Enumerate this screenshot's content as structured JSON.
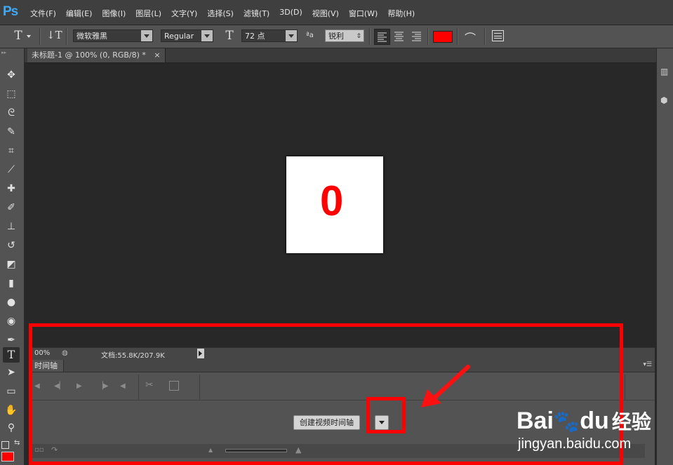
{
  "app": {
    "logo": "Ps"
  },
  "menu": [
    "文件(F)",
    "编辑(E)",
    "图像(I)",
    "图层(L)",
    "文字(Y)",
    "选择(S)",
    "滤镜(T)",
    "3D(D)",
    "视图(V)",
    "窗口(W)",
    "帮助(H)"
  ],
  "options": {
    "font_family": "微软雅黑",
    "font_style": "Regular",
    "font_size": "72 点",
    "aa_label": "ªa",
    "antialias": "锐利",
    "text_color": "#ff0000"
  },
  "document": {
    "tab_title": "未标题-1 @ 100% (0, RGB/8) *",
    "canvas_text": "0",
    "canvas_text_color": "#ff0000"
  },
  "status": {
    "zoom": "00%",
    "doc_info": "文档:55.8K/207.9K"
  },
  "timeline": {
    "tab_label": "时间轴",
    "create_button": "创建视频时间轴"
  },
  "watermark": {
    "brand": "Bai",
    "brand_du": "du",
    "brand_cn": "经验",
    "url": "jingyan.baidu.com"
  }
}
